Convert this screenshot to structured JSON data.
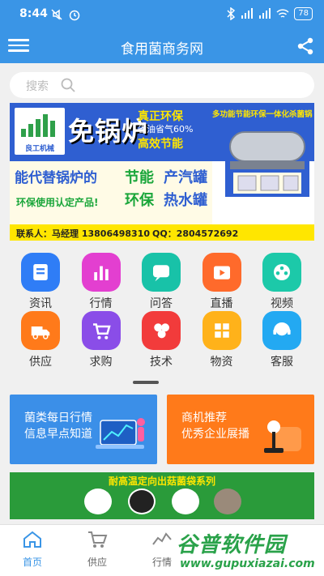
{
  "status_bar": {
    "time": "8:44",
    "battery": "78"
  },
  "app_bar": {
    "title": "食用菌商务网"
  },
  "search": {
    "placeholder": "搜索"
  },
  "banner": {
    "logo_text": "良工机械",
    "headline": "免锅炉",
    "tag1": "真正环保",
    "tag2": "省油省气60%",
    "tag3": "高效节能",
    "machine_title": "多功能节能环保一体化杀菌锅",
    "line1": "能代替锅炉的",
    "line2": "环保使用认定产品!",
    "big1": "节能",
    "big2": "产汽罐",
    "big3": "环保",
    "big4": "热水罐",
    "contact": "联系人：马经理 13806498310",
    "qq": "QQ：2804572692"
  },
  "categories": [
    {
      "label": "资讯",
      "icon": "news-icon",
      "color": "#2f7df6"
    },
    {
      "label": "行情",
      "icon": "market-chart-icon",
      "color": "#e33fd0"
    },
    {
      "label": "问答",
      "icon": "qa-icon",
      "color": "#18c2a8"
    },
    {
      "label": "直播",
      "icon": "live-icon",
      "color": "#ff6a2b"
    },
    {
      "label": "视频",
      "icon": "video-icon",
      "color": "#1cc9a9"
    },
    {
      "label": "供应",
      "icon": "supply-truck-icon",
      "color": "#ff7a1a"
    },
    {
      "label": "求购",
      "icon": "purchase-cart-icon",
      "color": "#8a4de8"
    },
    {
      "label": "技术",
      "icon": "tech-icon",
      "color": "#f23b3b"
    },
    {
      "label": "物资",
      "icon": "materials-icon",
      "color": "#ffb21a"
    },
    {
      "label": "客服",
      "icon": "customer-service-icon",
      "color": "#23a9f2"
    }
  ],
  "promos": {
    "left": {
      "line1": "菌类每日行情",
      "line2": "信息早点知道"
    },
    "right": {
      "line1": "商机推荐",
      "line2": "优秀企业展播"
    }
  },
  "bottom_banner": {
    "title": "耐高温定向出菇菌袋系列"
  },
  "tabbar": [
    {
      "label": "首页",
      "icon": "home-icon",
      "active": true
    },
    {
      "label": "供应",
      "icon": "cart-icon",
      "active": false
    },
    {
      "label": "行情",
      "icon": "trend-icon",
      "active": false
    }
  ],
  "watermark": {
    "main": "谷普软件园",
    "url": "www.gupuxiazai.com"
  }
}
